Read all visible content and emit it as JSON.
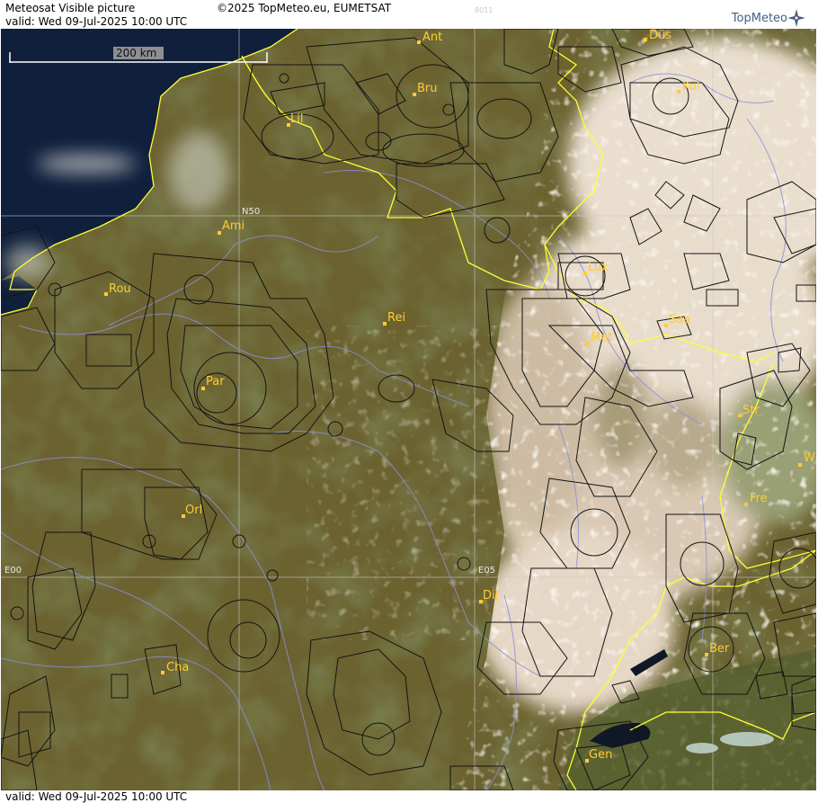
{
  "header": {
    "title": "Meteosat Visible picture",
    "copyright": "©2025 TopMeteo.eu, EUMETSAT",
    "code": "8011",
    "valid_top": "valid:  Wed  09-Jul-2025  10:00 UTC",
    "brand": "TopMeteo"
  },
  "footer": {
    "valid_bottom": "valid:  Wed  09-Jul-2025  10:00 UTC"
  },
  "scale_bar": {
    "label": "200 km"
  },
  "grid_labels": {
    "lat": "N50",
    "lon0": "E00",
    "lon5": "E05"
  },
  "cities": [
    {
      "id": "ant",
      "label": "Ant"
    },
    {
      "id": "dus",
      "label": "Düs"
    },
    {
      "id": "bru",
      "label": "Bru"
    },
    {
      "id": "kol",
      "label": "Köl"
    },
    {
      "id": "lil",
      "label": "Lil"
    },
    {
      "id": "ami",
      "label": "Ami"
    },
    {
      "id": "rou",
      "label": "Rou"
    },
    {
      "id": "lux",
      "label": "Lux"
    },
    {
      "id": "rei",
      "label": "Rei"
    },
    {
      "id": "saa",
      "label": "Saa"
    },
    {
      "id": "met",
      "label": "Met"
    },
    {
      "id": "par",
      "label": "Par"
    },
    {
      "id": "str",
      "label": "Str"
    },
    {
      "id": "wu",
      "label": "W"
    },
    {
      "id": "fre",
      "label": "Fre"
    },
    {
      "id": "orl",
      "label": "Orl"
    },
    {
      "id": "dij",
      "label": "Dij"
    },
    {
      "id": "ber",
      "label": "Ber"
    },
    {
      "id": "cha",
      "label": "Cha"
    },
    {
      "id": "gen",
      "label": "Gen"
    }
  ],
  "colors": {
    "land": "#6b6230",
    "sea": "#0f1f3c",
    "cloud": "#eee4d4",
    "border": "#ffff33",
    "airspace": "#141414",
    "river": "#8a8fd8",
    "grid": "#c8c8c8",
    "label": "#ffcc33"
  }
}
